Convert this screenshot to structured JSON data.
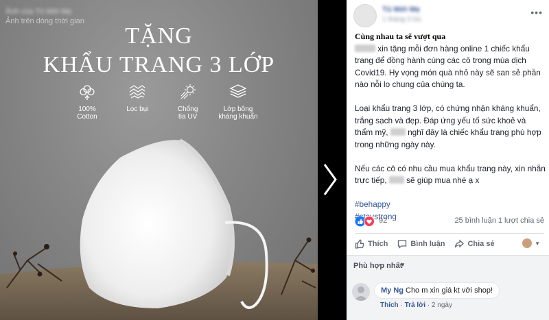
{
  "photo": {
    "top_line_1": "Ảnh của Tủ Mới Mẹ",
    "top_line_2": "Ảnh trên dòng thời gian",
    "title_line_1": "TẶNG",
    "title_line_2": "KHẨU TRANG 3 LỚP",
    "features": [
      {
        "icon": "cotton-icon",
        "line1": "100%",
        "line2": "Cotton"
      },
      {
        "icon": "filter-icon",
        "line1": "Lọc bụi",
        "line2": ""
      },
      {
        "icon": "sun-icon",
        "line1": "Chống",
        "line2": "tia UV"
      },
      {
        "icon": "layers-icon",
        "line1": "Lớp bông",
        "line2": "kháng khuẩn"
      }
    ]
  },
  "post": {
    "page_name": "Tủ Mới Mẹ",
    "meta": "1 tháng 3 lúc",
    "heading": "Cùng nhau ta sẽ vượt qua",
    "p1_after_name": " xin tặng mỗi đơn hàng online 1 chiếc khẩu trang để đồng hành cùng các cô trong mùa dịch Covid19. Hy vọng món quà nhỏ này sẽ san sẻ phần nào nỗi lo chung của chúng ta.",
    "p2_before_name": "Loại khẩu trang 3 lớp, có chứng nhận kháng khuẩn, trắng sạch và đẹp. Đáp ứng yếu tố sức khoẻ và thẩm mỹ, ",
    "p2_after_name": " nghĩ đây là chiếc khẩu trang phù hợp trong những ngày này.",
    "p3_before_name": "Nếu các cô có nhu cầu mua khẩu trang này, xin nhắn trực tiếp, ",
    "p3_after_name": " sẽ giúp mua nhé ạ x",
    "tags": [
      "#behappy",
      "#staystrong"
    ],
    "reaction_count": "92",
    "comment_count": "25 bình luận",
    "share_count": "1 lượt chia sẻ",
    "actions": {
      "like": "Thích",
      "comment": "Bình luận",
      "share": "Chia sẻ"
    }
  },
  "comments": {
    "sort_label": "Phù hợp nhất",
    "items": [
      {
        "author": "My Ng",
        "text": "Cho m xin giá kt với shop!",
        "like": "Thích",
        "reply": "Trả lời",
        "time": "2 ngày"
      }
    ]
  },
  "colors": {
    "link": "#385898",
    "like_blue": "#1877f2",
    "love_red": "#f33e58"
  }
}
